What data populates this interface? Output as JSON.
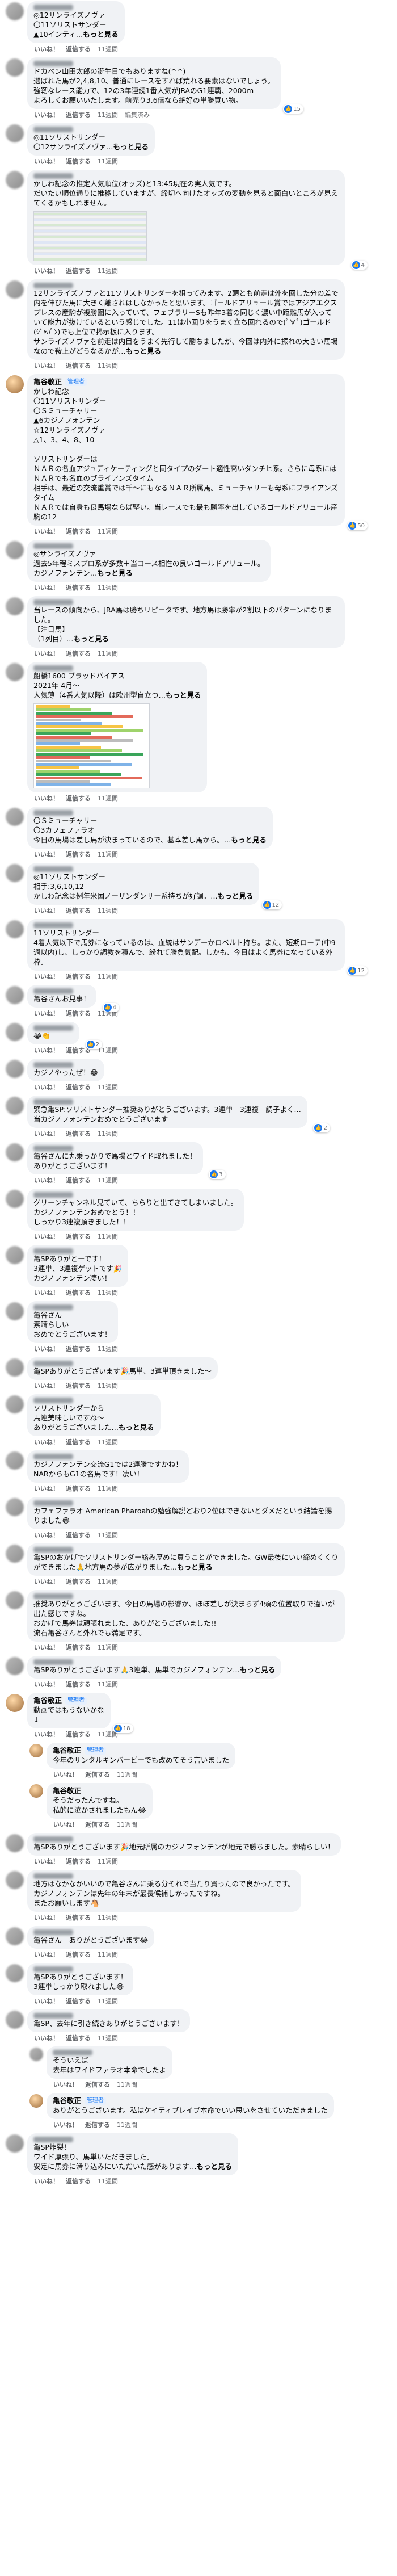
{
  "meta_labels": {
    "like": "いいね！",
    "reply": "返信する",
    "edit": "編集済み",
    "see_more": "もっと見る"
  },
  "comments": [
    {
      "indent": 0,
      "author": "",
      "text": "◎12サンライズノヴァ\n〇11ソリストサンダー\n▲10インティ…",
      "more": true,
      "time": "11週間",
      "reactions": ""
    },
    {
      "indent": 0,
      "author": "",
      "text": "ドカベン山田太郎の誕生日でもありますね(^^)\n選ばれた馬が2,4,8,10、普通にレースをすれば荒れる要素はないでしょう。\n強靭なレース能力で、12の3年連続1番人気がJRAのG1連覇、2000ｍ\nよろしくお願いいたします。前売り3.6倍なら絶好の単勝買い物。",
      "more": false,
      "time": "11週間",
      "reactions": "15",
      "edited": true
    },
    {
      "indent": 0,
      "author": "",
      "text": "◎11ソリストサンダー\n〇12サンライズノヴァ…",
      "more": true,
      "time": "11週間",
      "reactions": ""
    },
    {
      "indent": 0,
      "author": "",
      "text": "かしわ記念の推定人気順位(オッズ)と13:45現在の実人気です。\nだいたい順位通りに推移していますが、締切へ向けたオッズの変動を見ると面白いところが見えてくるかもしれません。",
      "more": false,
      "time": "11週間",
      "reactions": "4",
      "image": "table"
    },
    {
      "indent": 0,
      "author": "",
      "text": "12サンライズノヴァと11ソリストサンダーを狙ってみます。2頭とも前走は外を回した分の差で内を伸びた馬に大きく離されはしなかったと思います。ゴールドアリュール賞ではアジアエクスプレスの産駒が複勝圏に入っていて、フェブラリーSも昨年3着の同じく濃い中距離馬が入っていて能力が抜けているという感じでした。11は小回りをうまく立ち回れるので(ﾟ∀ﾟ)ゴールド(ｼﾞｬﾊﾟﾝ)でも上位で掲示板に入ります。\nサンライズノヴァを前走は内目をうまく先行して勝ちましたが、今回は内外に振れの大きい馬場なので鞍上がどうなるかが…",
      "more": true,
      "time": "11週間",
      "reactions": ""
    },
    {
      "indent": 0,
      "author": "亀谷敬正",
      "badge": "管理者",
      "text": "かしわ記念\n〇11ソリストサンダー\n〇Ｓミューチャリー\n▲6カジノフォンテン\n☆12サンライズノヴァ\n△1、3、4、8、10\n\nソリストサンダーは\nＮＡＲの名血アジュディケーティングと同タイプのダート適性高いダンチヒ系。さらに母系にはＮＡＲでも名血のブライアンズタイム\n相手は、最近の交流重賞では千〜にもなるＮＡＲ所属馬。ミューチャリーも母系にブライアンズタイム\nＮＡＲでは自身も良馬場ならば堅い。当レースでも最も勝率を出しているゴールドアリュール産駒の12",
      "more": false,
      "time": "11週間",
      "reactions": "50"
    },
    {
      "indent": 0,
      "author": "",
      "text": "◎サンライズノヴァ\n過去5年程ミスプロ系が多数＋当コース相性の良いゴールドアリュール。\nカジノフォンテン…",
      "more": true,
      "time": "11週間",
      "reactions": ""
    },
    {
      "indent": 0,
      "author": "",
      "text": "当レースの傾向から、JRA馬は勝ちリピータです。地方馬は勝率が2割以下のパターンになりました。\n【注目馬】\n（1列目）…",
      "more": true,
      "time": "11週間",
      "reactions": ""
    },
    {
      "indent": 0,
      "author": "",
      "text": "船橋1600 ブラッドバイアス\n2021年 4月〜\n人気薄（4番人気以降）は欧州型自立つ…",
      "more": true,
      "time": "11週間",
      "reactions": "",
      "image": "chart"
    },
    {
      "indent": 0,
      "author": "",
      "text": "〇Ｓミューチャリー\n〇3カフェファラオ\n今日の馬場は差し馬が決まっているので、基本差し馬から。…",
      "more": true,
      "time": "11週間",
      "reactions": ""
    },
    {
      "indent": 0,
      "author": "",
      "text": "◎11ソリストサンダー\n相手:3,6,10,12\nかしわ記念は例年米国ノーザンダンサー系持ちが好調。…",
      "more": true,
      "time": "11週間",
      "reactions": "12"
    },
    {
      "indent": 0,
      "author": "",
      "text": "11ソリストサンダー\n4着人気以下で馬券になっているのは、血統はサンデーかロベルト持ち。また、短期ローテ(中9週以内)し、しっかり調教を積んで、紛れて勝負気配。しかも、今日はよく馬券になっている外枠。",
      "more": false,
      "time": "11週間",
      "reactions": "12"
    },
    {
      "indent": 0,
      "author": "",
      "text": "亀谷さんお見事！",
      "emoji": "",
      "more": false,
      "time": "11週間",
      "reactions": "4"
    },
    {
      "indent": 0,
      "author": "",
      "text": "😂👏",
      "more": false,
      "time": "11週間",
      "reactions": "2"
    },
    {
      "indent": 0,
      "author": "",
      "text": "カジノやったぜ！😂",
      "more": false,
      "time": "11週間",
      "reactions": ""
    },
    {
      "indent": 0,
      "author": "",
      "text": "緊急亀SP:ソリストサンダー推奨ありがとうございます。3連単　3連複　調子よく…\n当カジノフォンテンおめでとうございます",
      "more": false,
      "time": "11週間",
      "reactions": "2"
    },
    {
      "indent": 0,
      "author": "",
      "text": "亀谷さんに丸乗っかりで馬場とワイド取れました！\nありがとうございます！",
      "more": false,
      "time": "11週間",
      "reactions": "3"
    },
    {
      "indent": 0,
      "author": "",
      "text": "グリーンチャンネル見ていて、ちらりと出てきてしまいました。\nカジノフォンテンおめでとう！！\nしっかり3連複頂きました！！",
      "more": false,
      "time": "11週間",
      "reactions": ""
    },
    {
      "indent": 0,
      "author": "",
      "text": "亀SPありがとーです！\n3連単、3連複ゲットです🎉\nカジノフォンテン凄い！",
      "more": false,
      "time": "11週間",
      "reactions": ""
    },
    {
      "indent": 0,
      "author": "",
      "text": "亀谷さん\n素晴らしい\nおめでとうございます！",
      "more": false,
      "time": "11週間",
      "reactions": ""
    },
    {
      "indent": 0,
      "author": "",
      "text": "亀SPありがとうございます🎉馬単、3連単頂きました〜",
      "more": false,
      "time": "11週間",
      "reactions": ""
    },
    {
      "indent": 0,
      "author": "",
      "text": "ソリストサンダーから\n馬連美味しいですね〜\nありがとうございました…",
      "more": true,
      "time": "11週間",
      "reactions": ""
    },
    {
      "indent": 0,
      "author": "",
      "text": "カジノフォンテン交流G1では2連勝ですかね！\nNARからもG1の名馬です！凄い！",
      "more": false,
      "time": "11週間",
      "reactions": ""
    },
    {
      "indent": 0,
      "author": "",
      "text": "カフェファラオ American Pharoahの勉強解説どおり2位はできないとダメだという結論を賜りました😂",
      "more": false,
      "time": "11週間",
      "reactions": ""
    },
    {
      "indent": 0,
      "author": "",
      "text": "亀SPのおかげでソリストサンダー絡み厚めに買うことができました。GW最後にいい締めくくりができました🙏地方馬の夢が広がりました…",
      "more": true,
      "time": "11週間",
      "reactions": ""
    },
    {
      "indent": 0,
      "author": "",
      "text": "推奨ありがとうございます。今日の馬場の影響か、ほぼ差しが決まらず4頭の位置取りで違いが出た感じですね。\nおかげで馬券は頑張れました、ありがとうございました!!\n流石亀谷さんと外れでも満足です。",
      "more": false,
      "time": "11週間",
      "reactions": ""
    },
    {
      "indent": 0,
      "author": "",
      "text": "亀SPありがとうございます🙏3連単、馬単でカジノフォンテン…",
      "more": true,
      "time": "11週間",
      "reactions": ""
    },
    {
      "indent": 0,
      "author": "亀谷敬正",
      "badge": "管理者",
      "text": "動画ではもうないかな\n↓",
      "more": false,
      "time": "11週間",
      "reactions": "18"
    },
    {
      "indent": 1,
      "author": "亀谷敬正",
      "badge": "管理者",
      "text": "今年のサンタルキンバービーでも改めてそう言いました",
      "more": false,
      "time": "11週間",
      "reactions": ""
    },
    {
      "indent": 1,
      "author": "亀谷敬正",
      "badge": "",
      "text": "そうだったんですね。\n私的に泣かされましたもん😂",
      "more": false,
      "time": "11週間",
      "reactions": ""
    },
    {
      "indent": 0,
      "author": "",
      "text": "亀SPありがとうございます🎉地元所属のカジノフォンテンが地元で勝ちました。素晴らしい！",
      "more": false,
      "time": "11週間",
      "reactions": ""
    },
    {
      "indent": 0,
      "author": "",
      "text": "地方はなかなかいいので亀谷さんに乗る分それで当たり買ったので良かったです。\nカジノフォンテンは先年の年末が最長候補しかったですね。\nまたお願いします🐴",
      "more": false,
      "time": "11週間",
      "reactions": ""
    },
    {
      "indent": 0,
      "author": "",
      "text": "亀谷さん　ありがとうございます😂",
      "more": false,
      "time": "11週間",
      "reactions": ""
    },
    {
      "indent": 0,
      "author": "",
      "text": "亀SPありがとうございます！\n3連単しっかり取れました😂",
      "more": false,
      "time": "11週間",
      "reactions": ""
    },
    {
      "indent": 0,
      "author": "",
      "text": "亀SP、去年に引き続きありがとうございます！",
      "more": false,
      "time": "11週間",
      "reactions": ""
    },
    {
      "indent": 1,
      "author": "",
      "text": "そういえば\n去年はワイドファラオ本命でしたよ",
      "more": false,
      "time": "11週間",
      "reactions": ""
    },
    {
      "indent": 1,
      "author": "亀谷敬正",
      "badge": "管理者",
      "text": "ありがとうございます。私はケイティブレイブ本命でいい思いをさせていただきました",
      "more": false,
      "time": "11週間",
      "reactions": ""
    },
    {
      "indent": 0,
      "author": "",
      "text": "亀SP炸裂！\nワイド厚張り、馬単いただきました。\n安定に馬券に滑り込みにいただいた感があります…",
      "more": true,
      "time": "11週間",
      "reactions": ""
    }
  ]
}
